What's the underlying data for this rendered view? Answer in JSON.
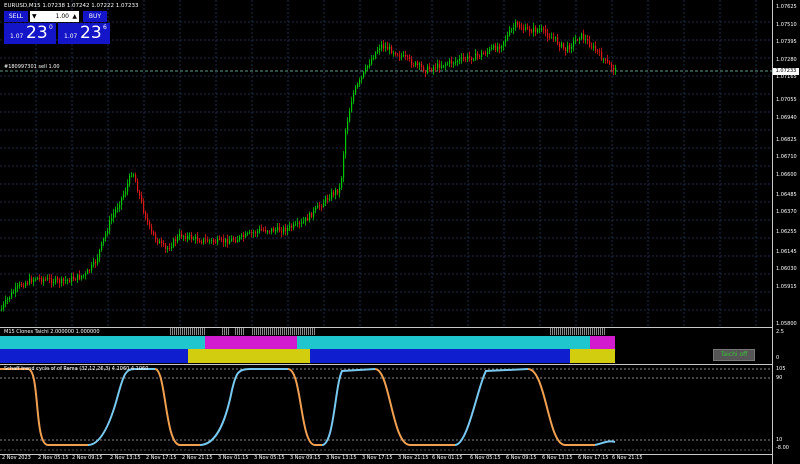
{
  "chart": {
    "title": "EURUSD,M15  1.07238 1.07242 1.07222 1.07233",
    "order_line_label": "#180997301 sell 1.00",
    "current_price": "1.07233",
    "price_labels": [
      "1.07625",
      "1.07510",
      "1.07395",
      "1.07280",
      "1.07165",
      "1.07055",
      "1.06940",
      "1.06825",
      "1.06710",
      "1.06600",
      "1.06485",
      "1.06370",
      "1.06255",
      "1.06145",
      "1.06030",
      "1.05915",
      "1.05800"
    ],
    "time_labels": [
      "2 Nov 2023",
      "2 Nov 05:15",
      "2 Nov 09:15",
      "2 Nov 13:15",
      "2 Nov 17:15",
      "2 Nov 21:15",
      "3 Nov 01:15",
      "3 Nov 05:15",
      "3 Nov 09:15",
      "3 Nov 13:15",
      "3 Nov 17:15",
      "3 Nov 21:15",
      "6 Nov 01:15",
      "6 Nov 05:15",
      "6 Nov 09:15",
      "6 Nov 13:15",
      "6 Nov 17:15",
      "6 Nov 21:15"
    ],
    "colors": {
      "bull": "#00c800",
      "bear": "#e01818",
      "grid": "#1e2a44",
      "order_line": "#5a9a8a"
    }
  },
  "trade_panel": {
    "sell_label": "SELL",
    "buy_label": "BUY",
    "volume": "1.00",
    "sell_small": "1.07",
    "sell_big": "23",
    "sell_sup": "0",
    "buy_small": "1.07",
    "buy_big": "23",
    "buy_sup": "6",
    "colors": {
      "sell": "#1414c8",
      "buy": "#1414c8",
      "field": "#ffffff"
    }
  },
  "indicator1": {
    "label": "M15 Clones Taichi 2.000000 1.000000",
    "scale_top": "2.5",
    "scale_bottom": "0",
    "button": "Taichi off",
    "colors": {
      "cyan": "#22d4dc",
      "magenta": "#e01cdc",
      "blue": "#1020dc",
      "yellow": "#e0dc10",
      "gray": "#8a8a8a"
    }
  },
  "indicator2": {
    "label": "Schaff trend cycle of of Rema (32,12,26,3) 4.1060 4.1060",
    "levels": [
      "105",
      "90",
      "10",
      "-8.00"
    ],
    "colors": {
      "up": "#78c8f0",
      "down": "#f0a050"
    }
  }
}
